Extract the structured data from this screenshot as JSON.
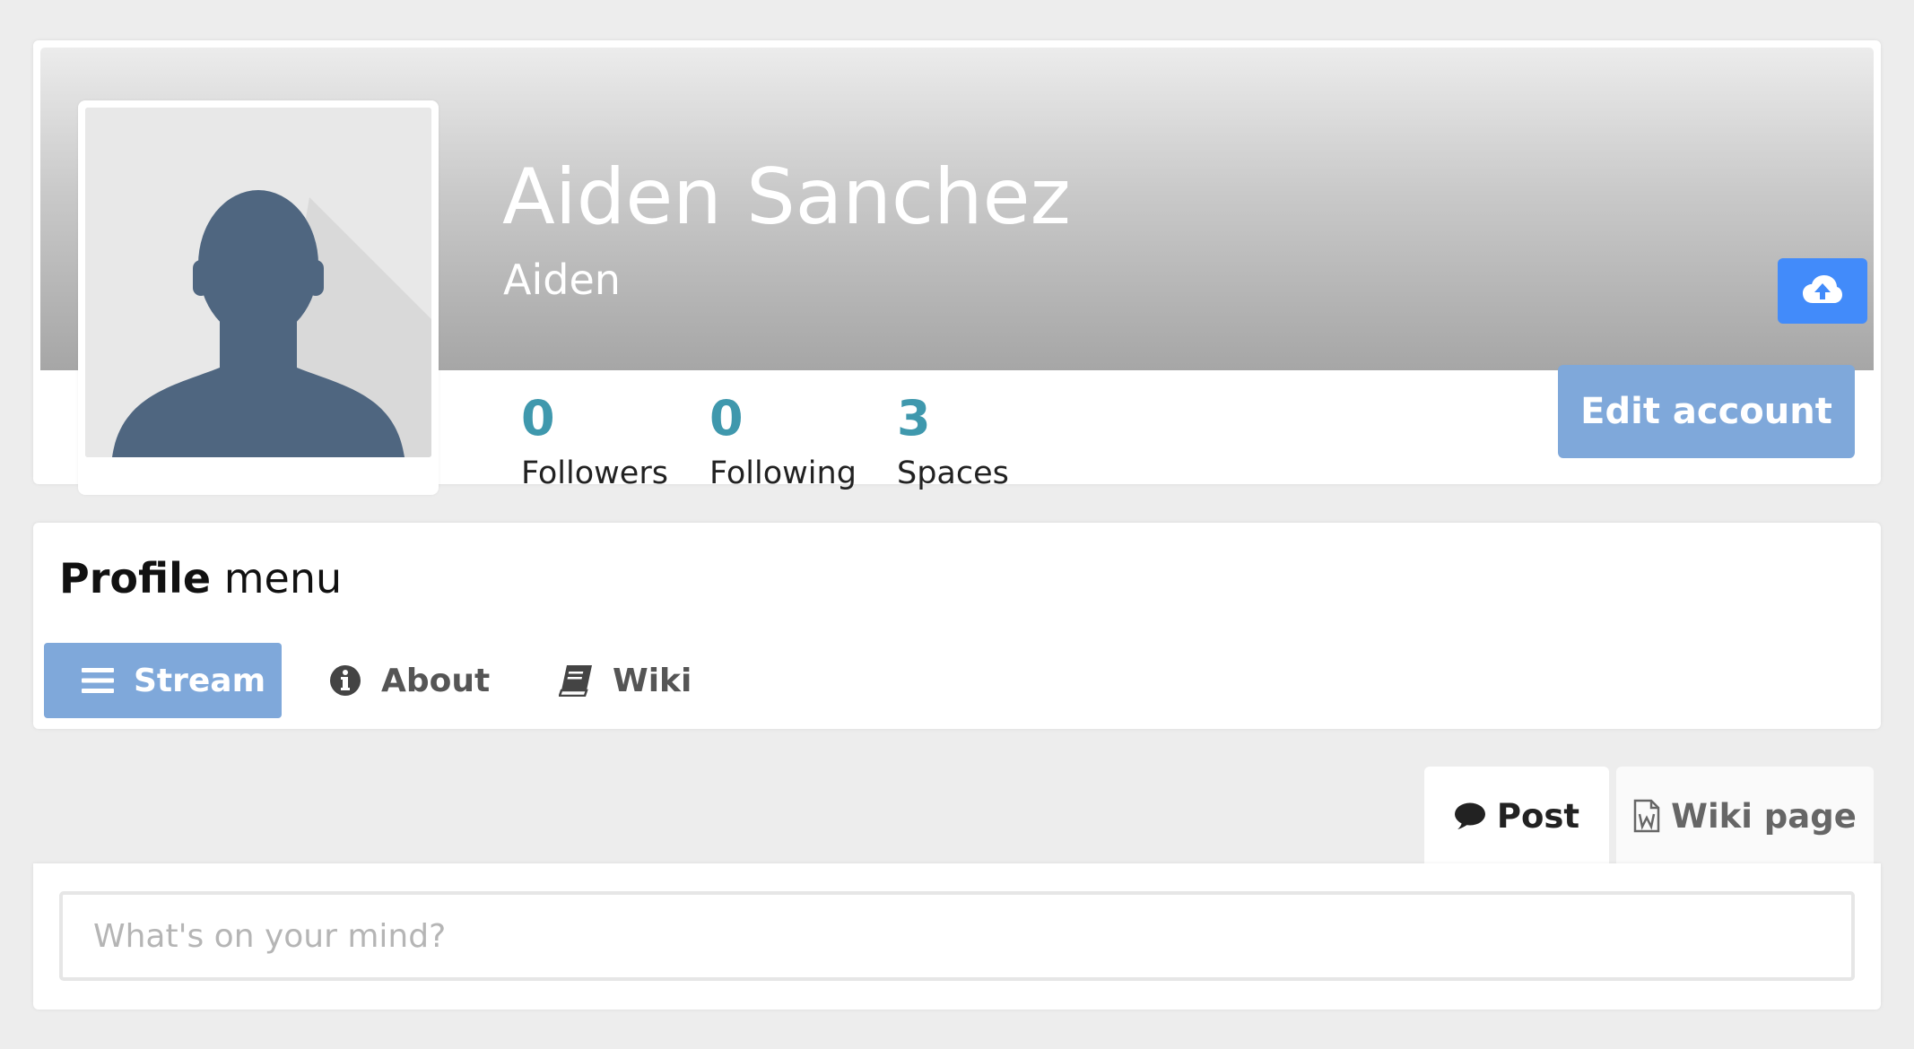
{
  "profile": {
    "display_name": "Aiden Sanchez",
    "username": "Aiden",
    "stats": [
      {
        "value": "0",
        "label": "Followers"
      },
      {
        "value": "0",
        "label": "Following"
      },
      {
        "value": "3",
        "label": "Spaces"
      }
    ],
    "edit_account_label": "Edit account",
    "upload_icon": "cloud-upload-icon"
  },
  "profile_menu": {
    "title_bold": "Profile",
    "title_rest": "menu",
    "items": [
      {
        "label": "Stream",
        "icon": "bars-icon",
        "active": true
      },
      {
        "label": "About",
        "icon": "info-circle-icon",
        "active": false
      },
      {
        "label": "Wiki",
        "icon": "book-icon",
        "active": false
      }
    ]
  },
  "composer": {
    "tabs": [
      {
        "label": "Post",
        "icon": "comment-icon",
        "active": true
      },
      {
        "label": "Wiki page",
        "icon": "word-file-icon",
        "active": false
      }
    ],
    "placeholder": "What's on your mind?"
  },
  "colors": {
    "accent_blue": "#428bfa",
    "button_blue": "#7fa8da",
    "stat_teal": "#3f98ad",
    "page_bg": "#ededed"
  }
}
